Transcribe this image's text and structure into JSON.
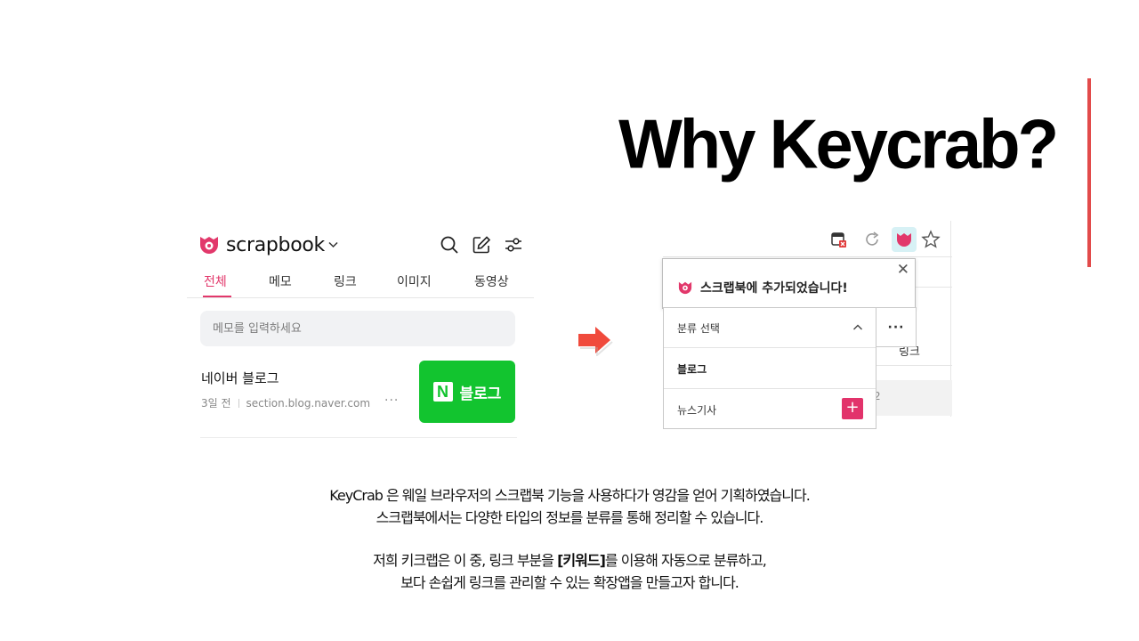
{
  "slide": {
    "title": "Why Keycrab?"
  },
  "scrapbook": {
    "logo_text": "scrapbook",
    "tabs": [
      {
        "label": "전체",
        "active": true
      },
      {
        "label": "메모"
      },
      {
        "label": "링크"
      },
      {
        "label": "이미지"
      },
      {
        "label": "동영상"
      }
    ],
    "memo_placeholder": "메모를 입력하세요",
    "item": {
      "title": "네이버 블로그",
      "age": "3일 전",
      "domain": "section.blog.naver.com",
      "more": "···",
      "thumbnail_label": "블로그",
      "thumbnail_letter": "N"
    },
    "accent_color": "#e2386b"
  },
  "extension_popup": {
    "close": "✕",
    "message": "스크랩북에 추가되었습니다!",
    "dropdown": {
      "header": "분류 선택",
      "options": [
        "블로그",
        "뉴스기사"
      ],
      "add": "+",
      "more": "···"
    },
    "background_text": [
      "링크",
      "2"
    ]
  },
  "description": {
    "line1": "KeyCrab 은 웨일 브라우저의 스크랩북 기능을 사용하다가 영감을 얻어 기획하였습니다.",
    "line2": "스크랩북에서는 다양한 타입의 정보를 분류를 통해 정리할 수 있습니다.",
    "line3_pre": "저희 키크랩은 이 중, 링크 부분을 ",
    "line3_bold": "[키워드]",
    "line3_post": "를 이용해 자동으로 분류하고,",
    "line4": "보다 손쉽게 링크를 관리할 수 있는 확장앱을 만들고자 합니다."
  }
}
